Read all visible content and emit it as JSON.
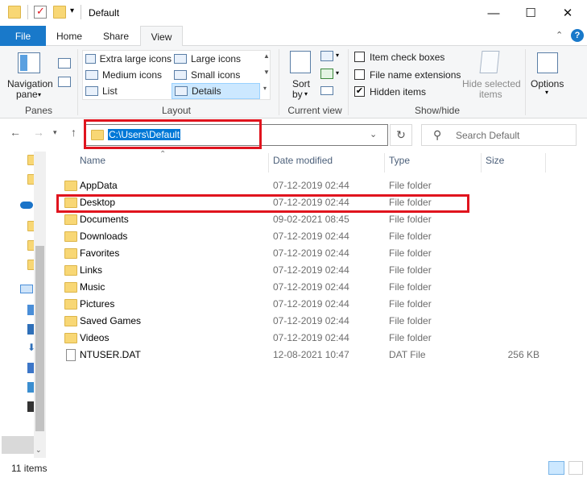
{
  "window": {
    "title": "Default",
    "minimize_glyph": "—",
    "maximize_glyph": "☐",
    "close_glyph": "✕"
  },
  "tabs": [
    {
      "label": "File"
    },
    {
      "label": "Home"
    },
    {
      "label": "Share"
    },
    {
      "label": "View"
    }
  ],
  "ribbon": {
    "panes": {
      "navigation_pane_line1": "Navigation",
      "navigation_pane_line2": "pane",
      "group_label": "Panes"
    },
    "layout": {
      "items": [
        "Extra large icons",
        "Large icons",
        "Medium icons",
        "Small icons",
        "List",
        "Details"
      ],
      "selected": "Details",
      "group_label": "Layout"
    },
    "current_view": {
      "sort_by_line1": "Sort",
      "sort_by_line2": "by",
      "group_label": "Current view"
    },
    "show_hide": {
      "item_check_boxes": "Item check boxes",
      "file_name_extensions": "File name extensions",
      "hidden_items": "Hidden items",
      "hide_selected_line1": "Hide selected",
      "hide_selected_line2": "items",
      "group_label": "Show/hide",
      "checkboxes": {
        "item_check_boxes": false,
        "file_name_extensions": false,
        "hidden_items": true
      }
    },
    "options": {
      "label": "Options"
    }
  },
  "address": {
    "path": "C:\\Users\\Default",
    "search_placeholder": "Search Default"
  },
  "columns": {
    "name": "Name",
    "date_modified": "Date modified",
    "type": "Type",
    "size": "Size"
  },
  "files": [
    {
      "name": "AppData",
      "date": "07-12-2019 02:44",
      "type": "File folder",
      "size": "",
      "kind": "folder"
    },
    {
      "name": "Desktop",
      "date": "07-12-2019 02:44",
      "type": "File folder",
      "size": "",
      "kind": "folder"
    },
    {
      "name": "Documents",
      "date": "09-02-2021 08:45",
      "type": "File folder",
      "size": "",
      "kind": "folder"
    },
    {
      "name": "Downloads",
      "date": "07-12-2019 02:44",
      "type": "File folder",
      "size": "",
      "kind": "folder"
    },
    {
      "name": "Favorites",
      "date": "07-12-2019 02:44",
      "type": "File folder",
      "size": "",
      "kind": "folder"
    },
    {
      "name": "Links",
      "date": "07-12-2019 02:44",
      "type": "File folder",
      "size": "",
      "kind": "folder"
    },
    {
      "name": "Music",
      "date": "07-12-2019 02:44",
      "type": "File folder",
      "size": "",
      "kind": "folder"
    },
    {
      "name": "Pictures",
      "date": "07-12-2019 02:44",
      "type": "File folder",
      "size": "",
      "kind": "folder"
    },
    {
      "name": "Saved Games",
      "date": "07-12-2019 02:44",
      "type": "File folder",
      "size": "",
      "kind": "folder"
    },
    {
      "name": "Videos",
      "date": "07-12-2019 02:44",
      "type": "File folder",
      "size": "",
      "kind": "folder"
    },
    {
      "name": "NTUSER.DAT",
      "date": "12-08-2021 10:47",
      "type": "DAT File",
      "size": "256 KB",
      "kind": "file"
    }
  ],
  "status": {
    "item_count": "11 items"
  },
  "colors": {
    "accent": "#1979ca",
    "selection": "#0078d7",
    "highlight_box": "#e0141e",
    "folder": "#f8d775"
  }
}
